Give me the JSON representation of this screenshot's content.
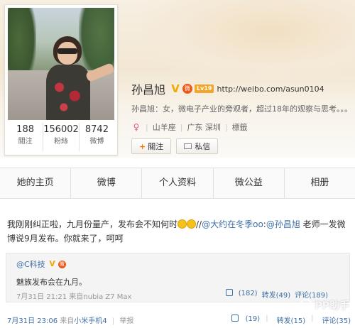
{
  "profile": {
    "name": "孙昌旭",
    "verified_icon": "V",
    "badge_icon": "微",
    "level_badge": "Lv19",
    "url": "http://weibo.com/asun0104",
    "bio": "孙昌旭：女，微电子产业的旁观者，超过18年的观察与思考。。。",
    "gender_icon": "female-icon",
    "constellation": "山羊座",
    "location": "广东 深圳",
    "tag": "標籤"
  },
  "stats": [
    {
      "value": "188",
      "label": "關注"
    },
    {
      "value": "156002",
      "label": "粉絲"
    },
    {
      "value": "8742",
      "label": "微博"
    }
  ],
  "buttons": {
    "follow": "關注",
    "message": "私信"
  },
  "nav": [
    "她的主页",
    "微博",
    "个人资料",
    "微公益",
    "相册"
  ],
  "post": {
    "text_before": "我刚刚纠正啦，九月份量产，发布会不知何时",
    "text_sep": "//",
    "mention1": "@大约在冬季oo",
    "colon": ":",
    "mention2": "@孙昌旭",
    "text_after": " 老师一发微博说9月发布。你就来了，呵呵",
    "repost": {
      "author": "@C科技",
      "text": "魅族发布会在九月。",
      "time": "7月31日 21:21",
      "source_prefix": "来自",
      "source": "nubia Z7 Max",
      "likes": "(182)",
      "reposts": "转发(49)",
      "comments": "评论(189)"
    },
    "footer": {
      "time": "7月31日 23:06",
      "source_prefix": "来自",
      "source": "小米手机4",
      "report": "举报",
      "likes": "(19)",
      "reposts": "转发(15)",
      "comments": "评论(35)"
    }
  },
  "watermark": "PP助手"
}
